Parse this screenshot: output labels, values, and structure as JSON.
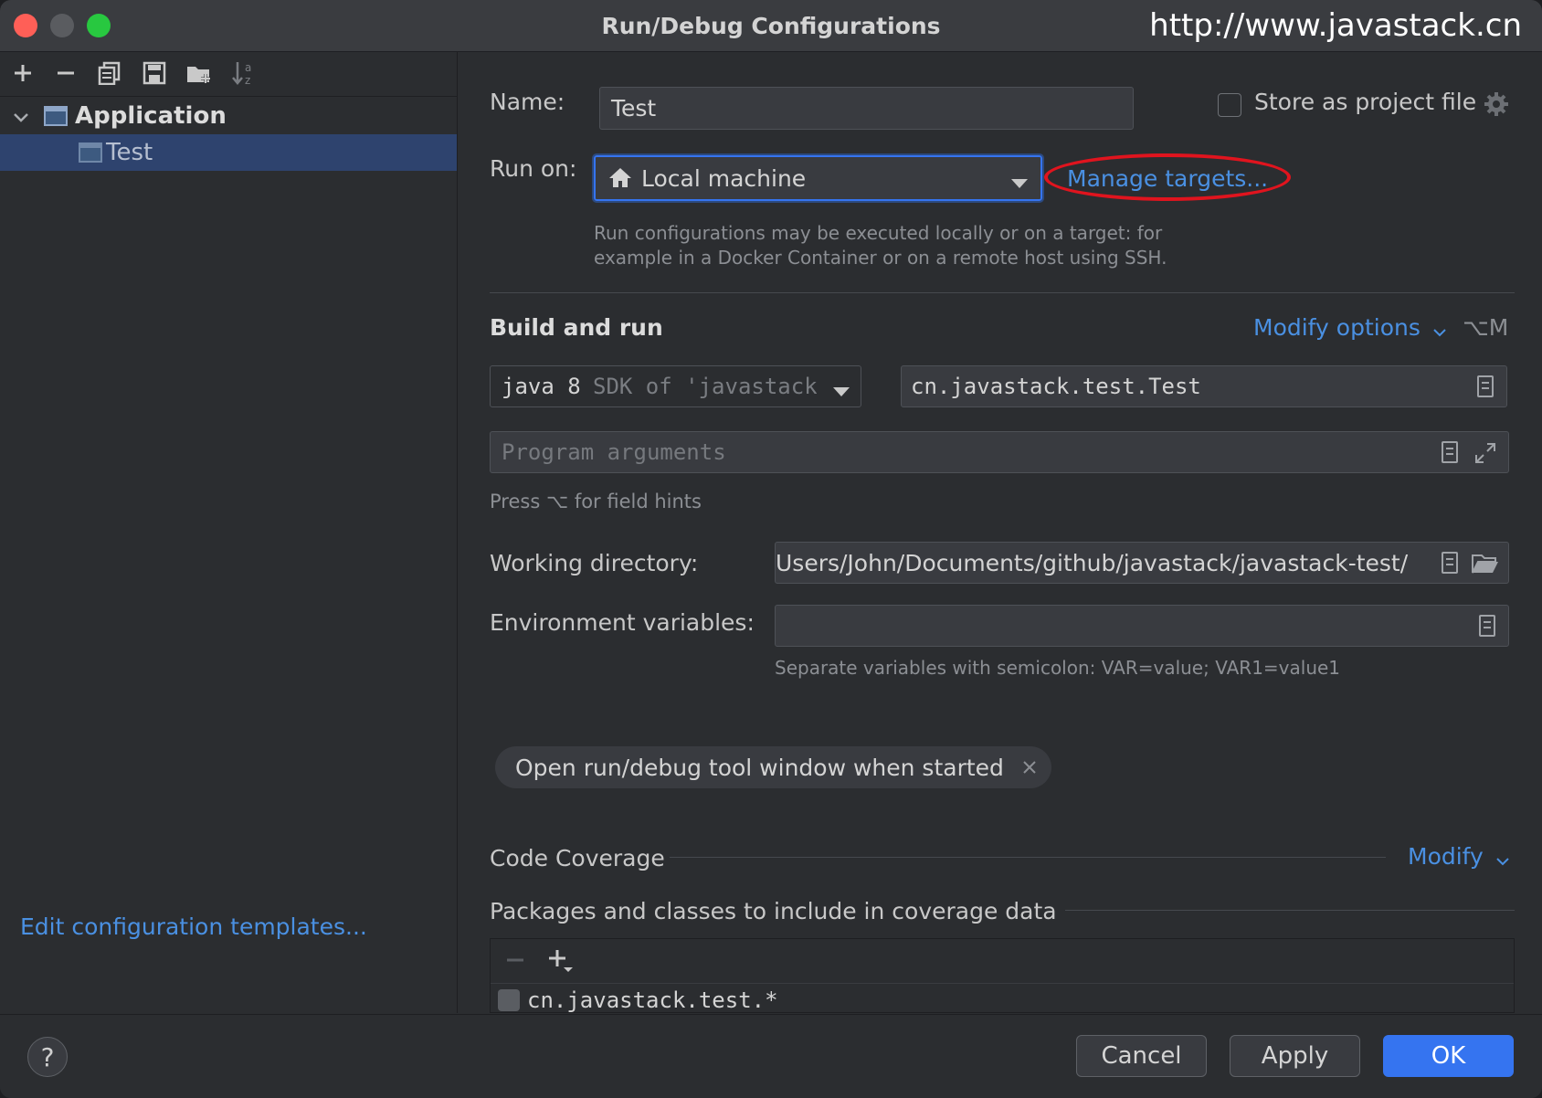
{
  "window": {
    "title": "Run/Debug Configurations",
    "watermark": "http://www.javastack.cn"
  },
  "tree": {
    "group_label": "Application",
    "item_label": "Test"
  },
  "left": {
    "edit_templates": "Edit configuration templates..."
  },
  "name": {
    "label": "Name:",
    "value": "Test",
    "store_label": "Store as project file"
  },
  "run_on": {
    "label": "Run on:",
    "value": "Local machine",
    "manage_link": "Manage targets...",
    "hint_line1": "Run configurations may be executed locally or on a target: for",
    "hint_line2": "example in a Docker Container or on a remote host using SSH."
  },
  "build": {
    "title": "Build and run",
    "modify_options": "Modify options",
    "shortcut": "⌥M",
    "sdk_main": "java 8",
    "sdk_sub": "SDK of 'javastack",
    "main_class": "cn.javastack.test.Test",
    "program_args_placeholder": "Program arguments",
    "field_hint": "Press ⌥ for field hints"
  },
  "working_dir": {
    "label": "Working directory:",
    "value": "/Users/John/Documents/github/javastack/javastack-test"
  },
  "env": {
    "label": "Environment variables:",
    "hint": "Separate variables with semicolon: VAR=value; VAR1=value1"
  },
  "tag": {
    "label": "Open run/debug tool window when started"
  },
  "coverage": {
    "title": "Code Coverage",
    "modify": "Modify",
    "packages_title": "Packages and classes to include in coverage data",
    "item_partial": "cn.javastack.test.*"
  },
  "footer": {
    "help": "?",
    "cancel": "Cancel",
    "apply": "Apply",
    "ok": "OK"
  },
  "colors": {
    "accent": "#3574f0",
    "link": "#4a90e2",
    "selection": "#2e436e",
    "annotation_circle": "#e0141e"
  }
}
